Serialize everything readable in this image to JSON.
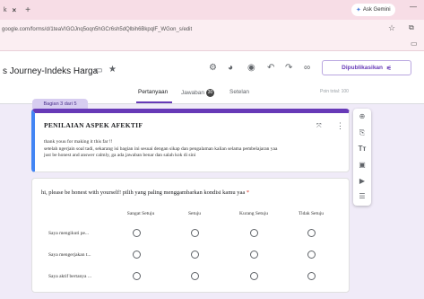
{
  "browser": {
    "tab_title": "k",
    "tab_close": "×",
    "new_tab": "+",
    "ask_gemini": "Ask Gemini",
    "minimize": "—",
    "url": "google.com/forms/d/1teaVIGOJnq5oqn5hGCr6sh5dQlbih6BkpqlF_WGon_s/edit"
  },
  "header": {
    "doc_title": "s Journey-Indeks Harga",
    "publish_label": "Dipublikasikan",
    "tabs": {
      "questions": "Pertanyaan",
      "responses": "Jawaban",
      "responses_count": "30",
      "settings": "Setelan"
    },
    "points_total": "Poin total: 100"
  },
  "section": {
    "label": "Bagian 3 dari 5",
    "title": "PENILAIAN ASPEK AFEKTIF",
    "description_line1": "thank youu for making it this far !!",
    "description_line2": "setelah ngerjain soal tadi, sekarang isi bagian ini sesuai dengan sikap dan pengalaman kalian selama pembelajaran yaa",
    "description_line3": "just be honest and answer calmly, ga ada jawaban benar dan salah kok di sini"
  },
  "question": {
    "text": "hi, please be honest with yourself! pilih yang paling menggambarkan kondisi kamu yaa",
    "required_mark": "*",
    "columns": [
      "Sangat Setuju",
      "Setuju",
      "Kurang Setuju",
      "Tidak Setuju"
    ],
    "rows": [
      "Saya mengikuti pe...",
      "Saya mengerjakan t...",
      "Saya aktif bertanya ..."
    ]
  }
}
